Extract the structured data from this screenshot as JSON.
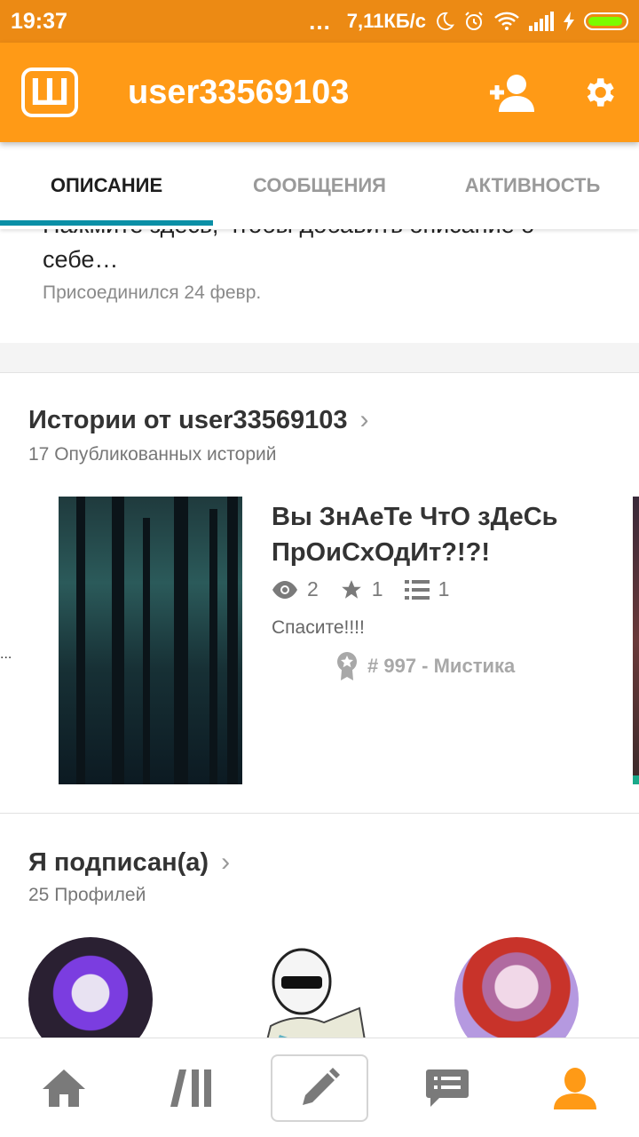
{
  "status_bar": {
    "time": "19:37",
    "dots": "...",
    "speed": "7,11КБ/с"
  },
  "app_bar": {
    "logo_letter": "Ш",
    "title": "user33569103"
  },
  "tabs": [
    {
      "label": "ОПИСАНИЕ",
      "active": true
    },
    {
      "label": "СООБЩЕНИЯ",
      "active": false
    },
    {
      "label": "АКТИВНОСТЬ",
      "active": false
    }
  ],
  "description": {
    "text_cut": "Нажмите здесь, чтобы добавить описание о",
    "text": "себе…",
    "joined": "Присоединился 24 февр."
  },
  "stories_section": {
    "title": "Истории от user33569103",
    "subtitle": "17 Опубликованных историй",
    "left_ellipsis": "...",
    "story": {
      "title": "Вы ЗнАеТе ЧтО зДеСь ПрОиСхОдИт?!?!",
      "views": "2",
      "votes": "1",
      "parts": "1",
      "description": "Спасите!!!!",
      "rank": "# 997 - Мистика"
    }
  },
  "following_section": {
    "title": "Я подписан(а)",
    "subtitle": "25 Профилей"
  },
  "colors": {
    "status_bar": "#ec8a14",
    "app_bar": "#ff9a16",
    "tab_indicator": "#0a8fa6",
    "active_nav": "#ff9a16"
  },
  "bottom_nav": [
    "home-icon",
    "library-icon",
    "pencil-icon",
    "messages-icon",
    "profile-icon"
  ]
}
